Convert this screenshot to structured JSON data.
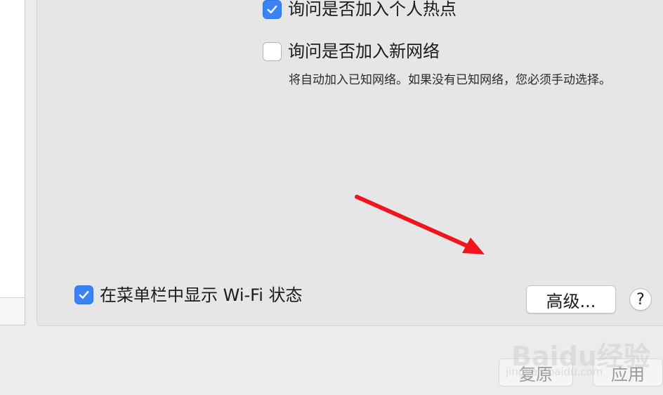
{
  "options": {
    "ask_join_hotspot": {
      "label": "询问是否加入个人热点",
      "checked": true
    },
    "ask_join_new_network": {
      "label": "询问是否加入新网络",
      "checked": false,
      "description": "将自动加入已知网络。如果没有已知网络，您必须手动选择。"
    },
    "show_wifi_in_menubar": {
      "label": "在菜单栏中显示 Wi-Fi 状态",
      "checked": true
    }
  },
  "buttons": {
    "advanced": "高级...",
    "help": "?",
    "revert": "复原",
    "apply": "应用"
  },
  "watermark": {
    "logo_text": "Baidu经验",
    "url": "jingyan.baidu.com"
  },
  "colors": {
    "accent": "#3b82f6",
    "annotation_arrow": "#f0141e"
  },
  "icons": {
    "checkmark": "check-icon",
    "annotation": "red-arrow-icon"
  }
}
